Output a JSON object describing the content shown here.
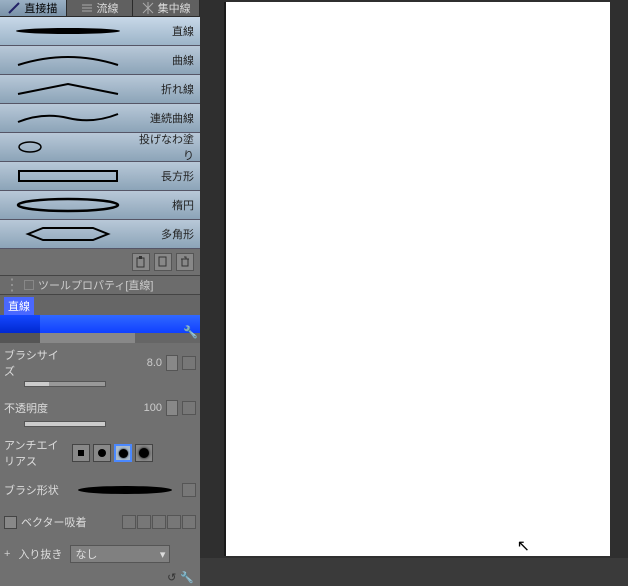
{
  "tabs": [
    {
      "label": "直接描"
    },
    {
      "label": "流線"
    },
    {
      "label": "集中線"
    }
  ],
  "tools": [
    {
      "name": "直線"
    },
    {
      "name": "曲線"
    },
    {
      "name": "折れ線"
    },
    {
      "name": "連続曲線"
    },
    {
      "name": "投げなわ塗り"
    },
    {
      "name": "長方形"
    },
    {
      "name": "楕円"
    },
    {
      "name": "多角形"
    }
  ],
  "propHeader": "ツールプロパティ[直線]",
  "colorLabel": "直線",
  "props": {
    "brushSize": {
      "label": "ブラシサイズ",
      "value": "8.0"
    },
    "opacity": {
      "label": "不透明度",
      "value": "100"
    },
    "antialias": {
      "label": "アンチエイリアス"
    },
    "brushShape": {
      "label": "ブラシ形状"
    },
    "vectorSnap": {
      "label": "ベクター吸着"
    },
    "startEnd": {
      "prefix": "+",
      "label": "入り抜き",
      "value": "なし"
    }
  }
}
